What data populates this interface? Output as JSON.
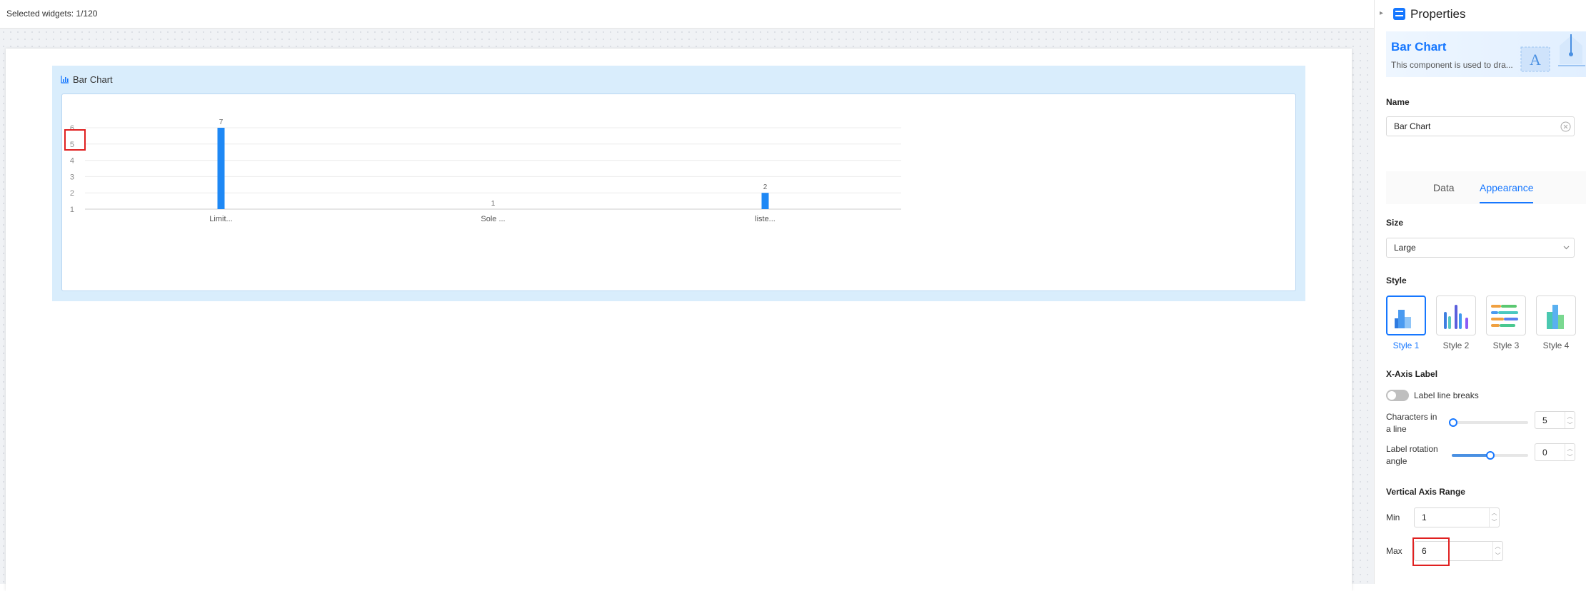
{
  "topbar": {
    "selected_widgets": "Selected widgets: 1/120"
  },
  "widget": {
    "title": "Bar Chart"
  },
  "chart_data": {
    "type": "bar",
    "categories": [
      "Limit...",
      "Sole ...",
      "liste..."
    ],
    "values": [
      7,
      1,
      2
    ],
    "ylim": [
      1,
      6
    ],
    "yticks": [
      "1",
      "2",
      "3",
      "4",
      "5",
      "6"
    ],
    "grid": true,
    "bar_color": "#1e88f5"
  },
  "panel": {
    "title": "Properties",
    "banner": {
      "title": "Bar Chart",
      "description": "This component is used to dra..."
    },
    "name_label": "Name",
    "name_value": "Bar Chart",
    "tabs": [
      "Data",
      "Appearance"
    ],
    "active_tab": "Appearance",
    "size_label": "Size",
    "size_value": "Large",
    "style_label": "Style",
    "styles": [
      "Style 1",
      "Style 2",
      "Style 3",
      "Style 4"
    ],
    "active_style": "Style 1",
    "xaxis_label": "X-Axis Label",
    "line_breaks_label": "Label line breaks",
    "line_breaks_on": false,
    "chars_label_1": "Characters in",
    "chars_label_2": "a line",
    "chars_value": "5",
    "rotation_label_1": "Label rotation",
    "rotation_label_2": "angle",
    "rotation_value": "0",
    "rotation_level": 0.5,
    "vrange_label": "Vertical Axis Range",
    "min_label": "Min",
    "min_value": "1",
    "max_label": "Max",
    "max_value": "6"
  },
  "colors": {
    "accent": "#1677ff",
    "highlight": "#e02020"
  }
}
